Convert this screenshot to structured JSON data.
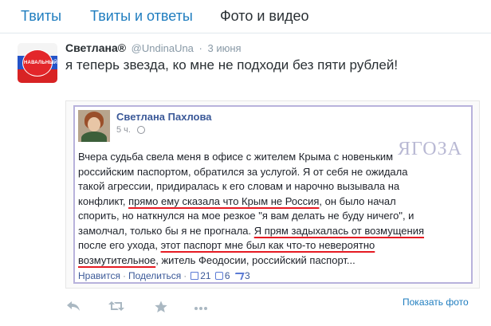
{
  "tabs": [
    {
      "label": "Твиты",
      "active": false
    },
    {
      "label": "Твиты и ответы",
      "active": false
    },
    {
      "label": "Фото и видео",
      "active": true
    }
  ],
  "tweet": {
    "author_name": "Светлана®",
    "handle": "@UndinaUna",
    "separator": "·",
    "time": "3 июня",
    "text": "я теперь звезда, ко мне не подходи без пяти рублей!",
    "avatar_label": "НАВАЛЬНЫЙ",
    "show_photo": "Показать фото"
  },
  "fb_post": {
    "author": "Светлана Пахлова",
    "time": "5 ч.",
    "watermark": "ЯГОЗА",
    "lines": [
      "Вчера судьба свела меня в офисе с жителем Крыма с новеньким",
      "российским паспортом, обратился за услугой. Я от себя не ожидала",
      "такой агрессии, придиралась к его словам и нарочно вызывала на"
    ],
    "line4_a": "конфликт, ",
    "line4_u": "прямо ему сказала что Крым не Россия",
    "line4_b": ", он было начал",
    "line5": "спорить, но наткнулся на мое резкое \"я вам делать не буду ничего\", и",
    "line6_a": "замолчал, только бы я не прогнала. ",
    "line6_u": "Я прям задыхалась от возмущения",
    "line7_a": "после его ухода, ",
    "line7_u": "этот паспорт мне был как что-то невероятно",
    "line8_u": "возмутительное",
    "line8_b": ", житель Феодосии, российский паспорт...",
    "like": "Нравится",
    "share": "Поделиться",
    "likes_count": "21",
    "comments_count": "6",
    "shares_count": "3"
  },
  "actions": {
    "reply_icon": "reply-icon",
    "retweet_icon": "retweet-icon",
    "favorite_icon": "star-icon",
    "more_icon": "more-icon"
  }
}
